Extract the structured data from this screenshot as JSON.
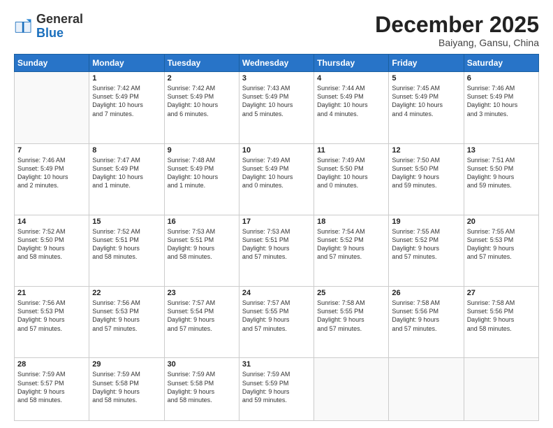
{
  "header": {
    "logo_general": "General",
    "logo_blue": "Blue",
    "month": "December 2025",
    "location": "Baiyang, Gansu, China"
  },
  "days_of_week": [
    "Sunday",
    "Monday",
    "Tuesday",
    "Wednesday",
    "Thursday",
    "Friday",
    "Saturday"
  ],
  "weeks": [
    [
      {
        "day": "",
        "info": ""
      },
      {
        "day": "1",
        "info": "Sunrise: 7:42 AM\nSunset: 5:49 PM\nDaylight: 10 hours\nand 7 minutes."
      },
      {
        "day": "2",
        "info": "Sunrise: 7:42 AM\nSunset: 5:49 PM\nDaylight: 10 hours\nand 6 minutes."
      },
      {
        "day": "3",
        "info": "Sunrise: 7:43 AM\nSunset: 5:49 PM\nDaylight: 10 hours\nand 5 minutes."
      },
      {
        "day": "4",
        "info": "Sunrise: 7:44 AM\nSunset: 5:49 PM\nDaylight: 10 hours\nand 4 minutes."
      },
      {
        "day": "5",
        "info": "Sunrise: 7:45 AM\nSunset: 5:49 PM\nDaylight: 10 hours\nand 4 minutes."
      },
      {
        "day": "6",
        "info": "Sunrise: 7:46 AM\nSunset: 5:49 PM\nDaylight: 10 hours\nand 3 minutes."
      }
    ],
    [
      {
        "day": "7",
        "info": "Sunrise: 7:46 AM\nSunset: 5:49 PM\nDaylight: 10 hours\nand 2 minutes."
      },
      {
        "day": "8",
        "info": "Sunrise: 7:47 AM\nSunset: 5:49 PM\nDaylight: 10 hours\nand 1 minute."
      },
      {
        "day": "9",
        "info": "Sunrise: 7:48 AM\nSunset: 5:49 PM\nDaylight: 10 hours\nand 1 minute."
      },
      {
        "day": "10",
        "info": "Sunrise: 7:49 AM\nSunset: 5:49 PM\nDaylight: 10 hours\nand 0 minutes."
      },
      {
        "day": "11",
        "info": "Sunrise: 7:49 AM\nSunset: 5:50 PM\nDaylight: 10 hours\nand 0 minutes."
      },
      {
        "day": "12",
        "info": "Sunrise: 7:50 AM\nSunset: 5:50 PM\nDaylight: 9 hours\nand 59 minutes."
      },
      {
        "day": "13",
        "info": "Sunrise: 7:51 AM\nSunset: 5:50 PM\nDaylight: 9 hours\nand 59 minutes."
      }
    ],
    [
      {
        "day": "14",
        "info": "Sunrise: 7:52 AM\nSunset: 5:50 PM\nDaylight: 9 hours\nand 58 minutes."
      },
      {
        "day": "15",
        "info": "Sunrise: 7:52 AM\nSunset: 5:51 PM\nDaylight: 9 hours\nand 58 minutes."
      },
      {
        "day": "16",
        "info": "Sunrise: 7:53 AM\nSunset: 5:51 PM\nDaylight: 9 hours\nand 58 minutes."
      },
      {
        "day": "17",
        "info": "Sunrise: 7:53 AM\nSunset: 5:51 PM\nDaylight: 9 hours\nand 57 minutes."
      },
      {
        "day": "18",
        "info": "Sunrise: 7:54 AM\nSunset: 5:52 PM\nDaylight: 9 hours\nand 57 minutes."
      },
      {
        "day": "19",
        "info": "Sunrise: 7:55 AM\nSunset: 5:52 PM\nDaylight: 9 hours\nand 57 minutes."
      },
      {
        "day": "20",
        "info": "Sunrise: 7:55 AM\nSunset: 5:53 PM\nDaylight: 9 hours\nand 57 minutes."
      }
    ],
    [
      {
        "day": "21",
        "info": "Sunrise: 7:56 AM\nSunset: 5:53 PM\nDaylight: 9 hours\nand 57 minutes."
      },
      {
        "day": "22",
        "info": "Sunrise: 7:56 AM\nSunset: 5:53 PM\nDaylight: 9 hours\nand 57 minutes."
      },
      {
        "day": "23",
        "info": "Sunrise: 7:57 AM\nSunset: 5:54 PM\nDaylight: 9 hours\nand 57 minutes."
      },
      {
        "day": "24",
        "info": "Sunrise: 7:57 AM\nSunset: 5:55 PM\nDaylight: 9 hours\nand 57 minutes."
      },
      {
        "day": "25",
        "info": "Sunrise: 7:58 AM\nSunset: 5:55 PM\nDaylight: 9 hours\nand 57 minutes."
      },
      {
        "day": "26",
        "info": "Sunrise: 7:58 AM\nSunset: 5:56 PM\nDaylight: 9 hours\nand 57 minutes."
      },
      {
        "day": "27",
        "info": "Sunrise: 7:58 AM\nSunset: 5:56 PM\nDaylight: 9 hours\nand 58 minutes."
      }
    ],
    [
      {
        "day": "28",
        "info": "Sunrise: 7:59 AM\nSunset: 5:57 PM\nDaylight: 9 hours\nand 58 minutes."
      },
      {
        "day": "29",
        "info": "Sunrise: 7:59 AM\nSunset: 5:58 PM\nDaylight: 9 hours\nand 58 minutes."
      },
      {
        "day": "30",
        "info": "Sunrise: 7:59 AM\nSunset: 5:58 PM\nDaylight: 9 hours\nand 58 minutes."
      },
      {
        "day": "31",
        "info": "Sunrise: 7:59 AM\nSunset: 5:59 PM\nDaylight: 9 hours\nand 59 minutes."
      },
      {
        "day": "",
        "info": ""
      },
      {
        "day": "",
        "info": ""
      },
      {
        "day": "",
        "info": ""
      }
    ]
  ]
}
